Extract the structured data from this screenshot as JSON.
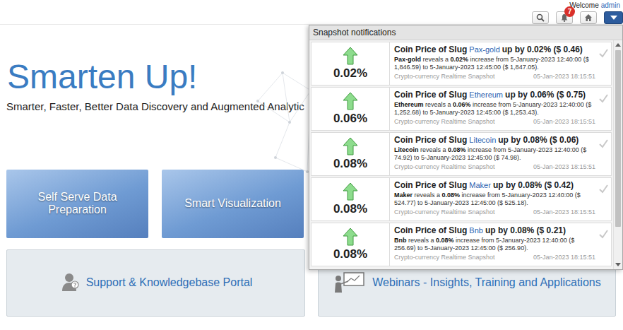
{
  "header": {
    "welcome": "Welcome",
    "user": "admin",
    "notification_count": "7"
  },
  "hero": {
    "title": "Smarten Up!",
    "subtitle": "Smarter, Faster, Better Data Discovery and Augmented Analytic"
  },
  "tiles": [
    {
      "label": "Self Serve Data Preparation"
    },
    {
      "label": "Smart Visualization"
    }
  ],
  "portals": [
    {
      "label": "Support & Knowledgebase Portal"
    },
    {
      "label": "Webinars - Insights, Training and Applications"
    }
  ],
  "notifications": {
    "title": "Snapshot notifications",
    "items": [
      {
        "percent": "0.02%",
        "title_prefix": "Coin Price of Slug",
        "coin": "Pax-gold",
        "title_suffix": "up by 0.02% ($ 0.46)",
        "description": [
          {
            "text": "Pax-gold",
            "bold": true
          },
          {
            "text": " reveals a ",
            "bold": false
          },
          {
            "text": "0.02%",
            "bold": true
          },
          {
            "text": " increase from 5-January-2023 12:40:00 ($ 1,846.59) to 5-January-2023 12:45:00 ($ 1,847.05).",
            "bold": false
          }
        ],
        "source": "Crypto-currency Realtime Snapshot",
        "time": "05-Jan-2023 18:15:51"
      },
      {
        "percent": "0.06%",
        "title_prefix": "Coin Price of Slug",
        "coin": "Ethereum",
        "title_suffix": "up by 0.06% ($ 0.75)",
        "description": [
          {
            "text": "Ethereum",
            "bold": true
          },
          {
            "text": " reveals a ",
            "bold": false
          },
          {
            "text": "0.06%",
            "bold": true
          },
          {
            "text": " increase from 5-January-2023 12:40:00 ($ 1,252.68) to 5-January-2023 12:45:00 ($ 1,253.43).",
            "bold": false
          }
        ],
        "source": "Crypto-currency Realtime Snapshot",
        "time": "05-Jan-2023 18:15:51"
      },
      {
        "percent": "0.08%",
        "title_prefix": "Coin Price of Slug",
        "coin": "Litecoin",
        "title_suffix": "up by 0.08% ($ 0.06)",
        "description": [
          {
            "text": "Litecoin",
            "bold": true
          },
          {
            "text": " reveals a ",
            "bold": false
          },
          {
            "text": "0.08%",
            "bold": true
          },
          {
            "text": " increase from 5-January-2023 12:40:00 ($ 74.92) to 5-January-2023 12:45:00 ($ 74.98).",
            "bold": false
          }
        ],
        "source": "Crypto-currency Realtime Snapshot",
        "time": "05-Jan-2023 18:15:51"
      },
      {
        "percent": "0.08%",
        "title_prefix": "Coin Price of Slug",
        "coin": "Maker",
        "title_suffix": "up by 0.08% ($ 0.42)",
        "description": [
          {
            "text": "Maker",
            "bold": true
          },
          {
            "text": " reveals a ",
            "bold": false
          },
          {
            "text": "0.08%",
            "bold": true
          },
          {
            "text": " increase from 5-January-2023 12:40:00 ($ 524.77) to 5-January-2023 12:45:00 ($ 525.18).",
            "bold": false
          }
        ],
        "source": "Crypto-currency Realtime Snapshot",
        "time": "05-Jan-2023 18:15:51"
      },
      {
        "percent": "0.08%",
        "title_prefix": "Coin Price of Slug",
        "coin": "Bnb",
        "title_suffix": "up by 0.08% ($ 0.21)",
        "description": [
          {
            "text": "Bnb",
            "bold": true
          },
          {
            "text": " reveals a ",
            "bold": false
          },
          {
            "text": "0.08%",
            "bold": true
          },
          {
            "text": " increase from 5-January-2023 12:40:00 ($ 256.69) to 5-January-2023 12:45:00 ($ 256.90).",
            "bold": false
          }
        ],
        "source": "Crypto-currency Realtime Snapshot",
        "time": "05-Jan-2023 18:15:51"
      }
    ]
  }
}
